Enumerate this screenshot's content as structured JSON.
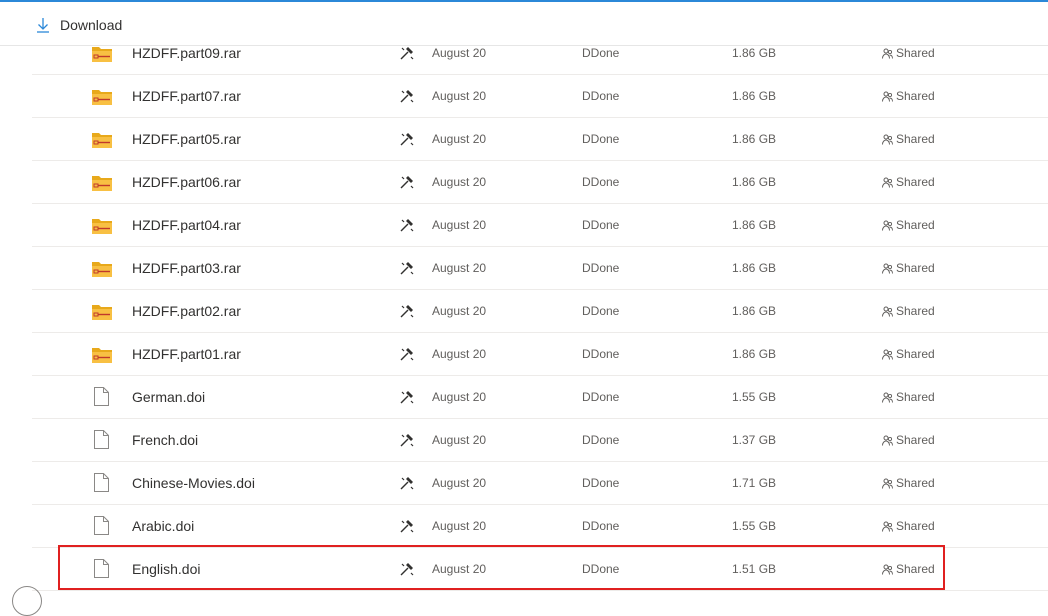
{
  "toolbar": {
    "download_label": "Download"
  },
  "files": [
    {
      "name": "HZDFF.part09.rar",
      "icon": "folder-zip-icon",
      "modified": "August 20",
      "owner": "DDone",
      "size": "1.86 GB",
      "sharing": "Shared"
    },
    {
      "name": "HZDFF.part07.rar",
      "icon": "folder-zip-icon",
      "modified": "August 20",
      "owner": "DDone",
      "size": "1.86 GB",
      "sharing": "Shared"
    },
    {
      "name": "HZDFF.part05.rar",
      "icon": "folder-zip-icon",
      "modified": "August 20",
      "owner": "DDone",
      "size": "1.86 GB",
      "sharing": "Shared"
    },
    {
      "name": "HZDFF.part06.rar",
      "icon": "folder-zip-icon",
      "modified": "August 20",
      "owner": "DDone",
      "size": "1.86 GB",
      "sharing": "Shared"
    },
    {
      "name": "HZDFF.part04.rar",
      "icon": "folder-zip-icon",
      "modified": "August 20",
      "owner": "DDone",
      "size": "1.86 GB",
      "sharing": "Shared"
    },
    {
      "name": "HZDFF.part03.rar",
      "icon": "folder-zip-icon",
      "modified": "August 20",
      "owner": "DDone",
      "size": "1.86 GB",
      "sharing": "Shared"
    },
    {
      "name": "HZDFF.part02.rar",
      "icon": "folder-zip-icon",
      "modified": "August 20",
      "owner": "DDone",
      "size": "1.86 GB",
      "sharing": "Shared"
    },
    {
      "name": "HZDFF.part01.rar",
      "icon": "folder-zip-icon",
      "modified": "August 20",
      "owner": "DDone",
      "size": "1.86 GB",
      "sharing": "Shared"
    },
    {
      "name": "German.doi",
      "icon": "file-icon",
      "modified": "August 20",
      "owner": "DDone",
      "size": "1.55 GB",
      "sharing": "Shared"
    },
    {
      "name": "French.doi",
      "icon": "file-icon",
      "modified": "August 20",
      "owner": "DDone",
      "size": "1.37 GB",
      "sharing": "Shared"
    },
    {
      "name": "Chinese-Movies.doi",
      "icon": "file-icon",
      "modified": "August 20",
      "owner": "DDone",
      "size": "1.71 GB",
      "sharing": "Shared"
    },
    {
      "name": "Arabic.doi",
      "icon": "file-icon",
      "modified": "August 20",
      "owner": "DDone",
      "size": "1.55 GB",
      "sharing": "Shared"
    },
    {
      "name": "English.doi",
      "icon": "file-icon",
      "modified": "August 20",
      "owner": "DDone",
      "size": "1.51 GB",
      "sharing": "Shared"
    }
  ],
  "colors": {
    "accent": "#2b88d8",
    "folder": "#f8c043",
    "highlight": "#e02020"
  }
}
